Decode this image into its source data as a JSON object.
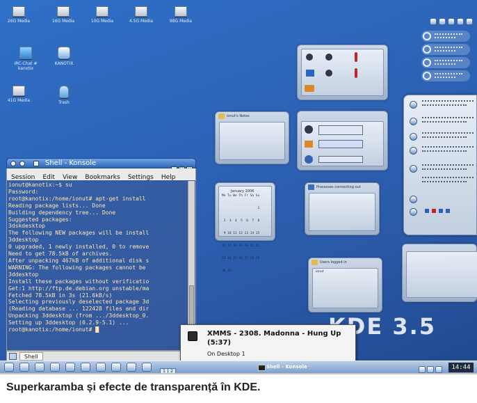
{
  "desktop_icons": [
    {
      "label": "26G Media"
    },
    {
      "label": "16G Media"
    },
    {
      "label": "10G Media"
    },
    {
      "label": "4.5G Media"
    },
    {
      "label": "98G Media"
    },
    {
      "label": "IRC-Chat #\nkanotix"
    },
    {
      "label": "KANOTIX"
    },
    {
      "label": "41G Media"
    },
    {
      "label": "Trash"
    }
  ],
  "widgets": {
    "notes_title": "ionut's Notes",
    "calendar": {
      "month": "January 2006",
      "days_header": "Mo Tu We Th Fr Sa Su",
      "rows": [
        "                   1",
        " 2  3  4  5  6  7  8",
        " 9 10 11 12 13 14 15",
        "16 17 18 19 20 21 22",
        "23 24 25 26 27 28 29",
        "30 31"
      ]
    },
    "processes_title": "Processes connecting out",
    "users_title": "Users logged in",
    "users_user": "ionut"
  },
  "konsole": {
    "title": "Shell - Konsole",
    "menu": [
      "Session",
      "Edit",
      "View",
      "Bookmarks",
      "Settings",
      "Help"
    ],
    "lines": [
      "ionut@kanotix:~$ su",
      "Password:",
      "root@kanotix:/home/ionut# apt-get install",
      "Reading package lists... Done",
      "Building dependency tree... Done",
      "Suggested packages:",
      "  3dskdesktop",
      "The following NEW packages will be install",
      "  3ddesktop",
      "0 upgraded, 1 newly installed, 0 to remove",
      "Need to get 78.5kB of archives.",
      "After unpacking 467kB of additional disk s",
      "WARNING: The following packages cannot be",
      "  3ddesktop",
      "Install these packages without verificatio",
      "Get:1 http://ftp.de.debian.org unstable/ma",
      "Fetched 78.5kB in 3s (21.6kB/s)",
      "Selecting previously deselected package 3d",
      "(Reading database ... 122428 files and dir",
      "Unpacking 3ddesktop (from .../3ddesktop_0.",
      "Setting up 3ddesktop (0.2.9-5.1) ...",
      "root@kanotix:/home/ionut# █"
    ],
    "tab_label": "Shell"
  },
  "xmms_popup": {
    "title": "XMMS - 2308. Madonna - Hung Up (5:37)",
    "subtitle": "On Desktop 1"
  },
  "taskbar": {
    "pager": [
      "1",
      "2",
      "3",
      "4"
    ],
    "task_label": "Shell - Konsole",
    "clock": "14:44"
  },
  "kde_logo": "KDE 3.5",
  "caption": "Superkaramba și efecte de transparență în KDE."
}
